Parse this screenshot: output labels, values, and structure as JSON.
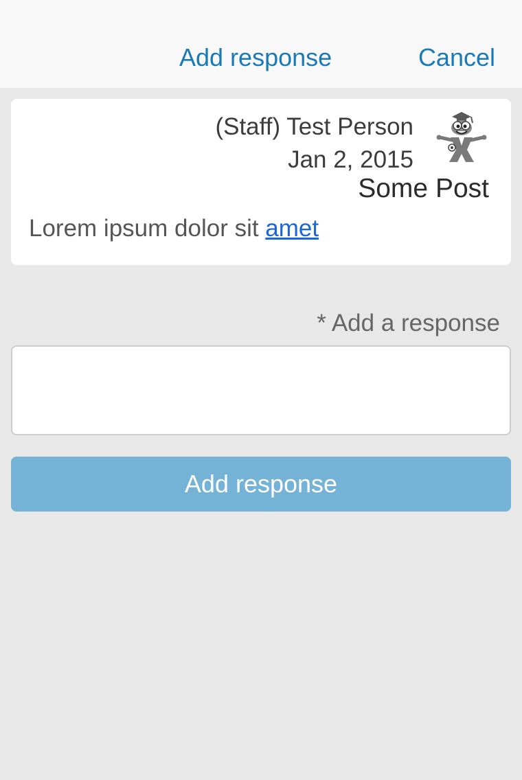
{
  "navbar": {
    "title": "Add response",
    "cancel_label": "Cancel"
  },
  "post": {
    "author": "(Staff) Test Person",
    "date": "Jan 2, 2015",
    "title": "Some Post",
    "body_text": "Lorem ipsum dolor sit ",
    "body_link": "amet",
    "avatar_icon": "mascot-avatar-icon"
  },
  "response_form": {
    "label": "* Add a response",
    "value": "",
    "placeholder": "",
    "submit_label": "Add response"
  },
  "colors": {
    "accent": "#1a7ab8",
    "link": "#1a66d8",
    "submit_button": "#74b2d6",
    "background": "#e8e8e8"
  }
}
